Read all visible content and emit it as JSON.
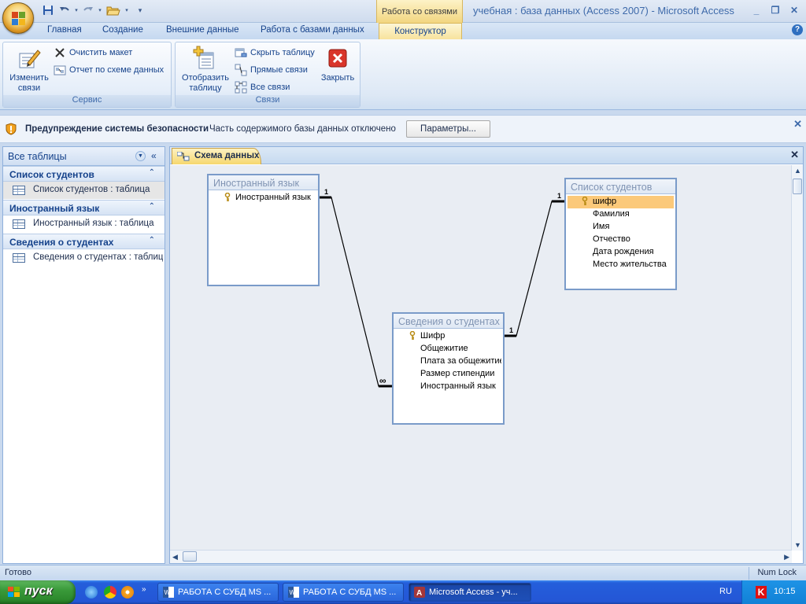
{
  "window": {
    "title": "учебная : база данных (Access 2007) - Microsoft Access",
    "context_tab_label": "Работа со связями",
    "controls": [
      "_",
      "❐",
      "✕"
    ]
  },
  "qat": {
    "icons": [
      "save-icon",
      "undo-icon",
      "redo-icon",
      "open-icon",
      "customize-icon"
    ]
  },
  "tabs": [
    "Главная",
    "Создание",
    "Внешние данные",
    "Работа с базами данных",
    "Конструктор"
  ],
  "ribbon": {
    "service": {
      "caption": "Сервис",
      "edit_relations": [
        "Изменить",
        "связи"
      ],
      "clear_layout": "Очистить макет",
      "relations_report": "Отчет по схеме данных"
    },
    "relations": {
      "caption": "Связи",
      "show_table": [
        "Отобразить",
        "таблицу"
      ],
      "hide_table": "Скрыть таблицу",
      "direct_relations": "Прямые связи",
      "all_relations": "Все связи",
      "close": "Закрыть"
    }
  },
  "security_bar": {
    "title": "Предупреждение системы безопасности",
    "message": "Часть содержимого базы данных отключено",
    "button": "Параметры..."
  },
  "nav_pane": {
    "title": "Все таблицы",
    "groups": [
      {
        "label": "Список студентов",
        "item": "Список студентов : таблица"
      },
      {
        "label": "Иностранный язык",
        "item": "Иностранный язык : таблица"
      },
      {
        "label": "Сведения о студентах",
        "item": "Сведения о студентах : таблица"
      }
    ]
  },
  "document": {
    "tab_label": "Схема данных",
    "tables": [
      {
        "title": "Иностранный язык",
        "fields": [
          "Иностранный язык"
        ],
        "key_field": 0,
        "selected_field": -1
      },
      {
        "title": "Список студентов",
        "fields": [
          "шифр",
          "Фамилия",
          "Имя",
          "Отчество",
          "Дата рождения",
          "Место жительства"
        ],
        "key_field": 0,
        "selected_field": 0
      },
      {
        "title": "Сведения о студентах",
        "fields": [
          "Шифр",
          "Общежитие",
          "Плата за общежитие",
          "Размер стипендии",
          "Иностранный язык"
        ],
        "key_field": 0,
        "selected_field": -1
      }
    ],
    "relation_marks": {
      "one": "1",
      "many": "∞"
    }
  },
  "status_bar": {
    "left": "Готово",
    "right": "Num Lock"
  },
  "taskbar": {
    "start_label": "пуск",
    "tasks": [
      "РАБОТА С СУБД MS ...",
      "РАБОТА С СУБД MS ...",
      "Microsoft Access - уч..."
    ],
    "language": "RU",
    "clock": "10:15"
  },
  "colors": {
    "accent": "#15428b",
    "selected_field": "#fbc97a",
    "context_tab": "#f7e29a"
  }
}
